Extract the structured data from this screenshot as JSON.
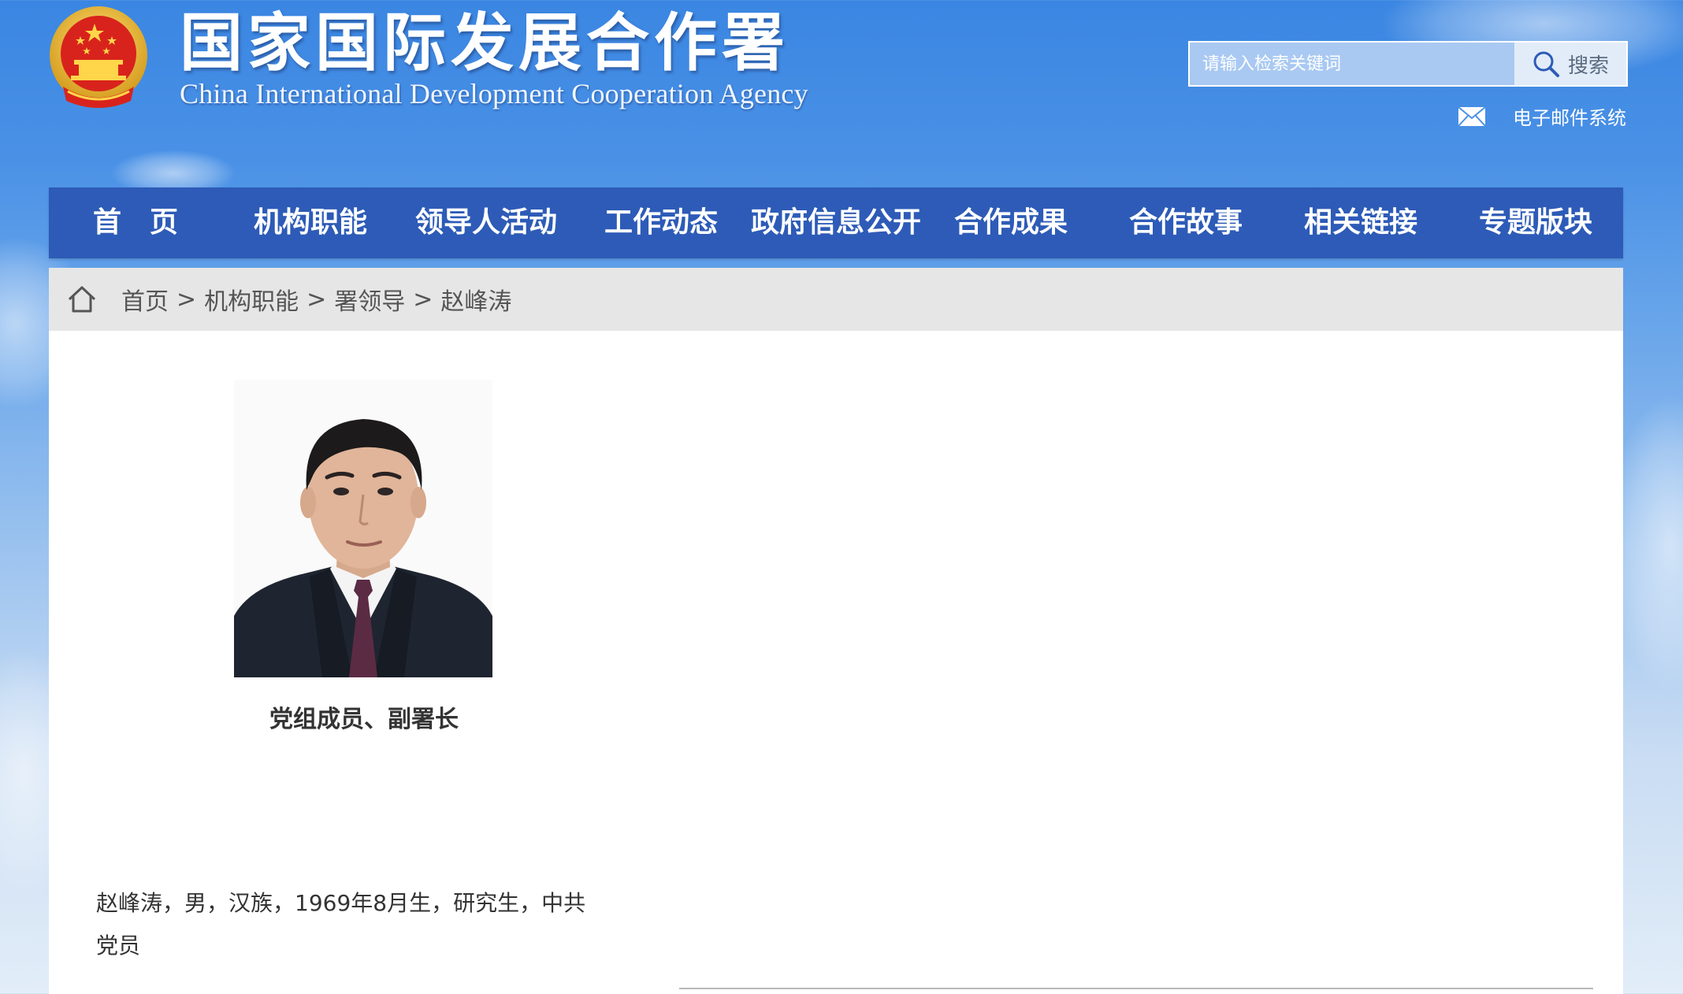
{
  "header": {
    "title_cn": "国家国际发展合作署",
    "title_en": "China International Development Cooperation Agency"
  },
  "search": {
    "placeholder": "请输入检索关键词",
    "button_label": "搜索"
  },
  "mail": {
    "label": "电子邮件系统"
  },
  "nav": {
    "items": [
      {
        "label": "首　页"
      },
      {
        "label": "机构职能"
      },
      {
        "label": "领导人活动"
      },
      {
        "label": "工作动态"
      },
      {
        "label": "政府信息公开"
      },
      {
        "label": "合作成果"
      },
      {
        "label": "合作故事"
      },
      {
        "label": "相关链接"
      },
      {
        "label": "专题版块"
      }
    ]
  },
  "breadcrumb": {
    "items": [
      "首页",
      "机构职能",
      "署领导",
      "赵峰涛"
    ],
    "separator": ">"
  },
  "profile": {
    "caption": "党组成员、副署长",
    "bio_line1": "赵峰涛，男，汉族，1969年8月生，研究生，中共",
    "bio_line2": "党员"
  },
  "colors": {
    "nav_bg": "#2d5bb7",
    "breadcrumb_bg": "#e6e6e6",
    "sky_top": "#3a86e2"
  }
}
